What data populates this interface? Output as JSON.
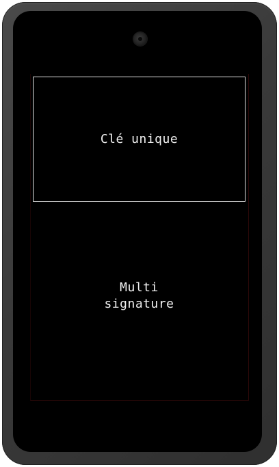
{
  "menu": {
    "options": [
      {
        "label": "Clé unique",
        "selected": true
      },
      {
        "label": "Multi\nsignature",
        "selected": false
      }
    ]
  },
  "colors": {
    "screen_background": "#000000",
    "device_body": "#3a3a3a",
    "text": "#f2f2f2",
    "selection_border": "#e6e6e6"
  },
  "icons": {
    "camera": "front-camera-icon"
  }
}
